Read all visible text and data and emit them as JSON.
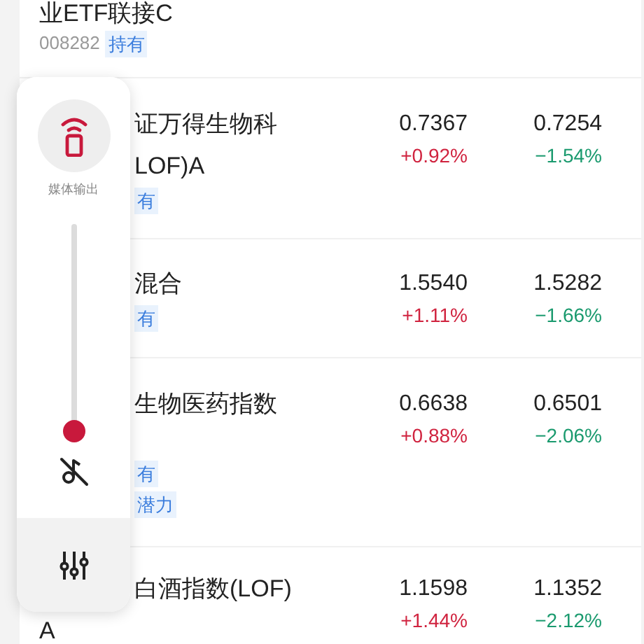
{
  "funds": [
    {
      "name_lines": [
        "业ETF联接C"
      ],
      "code": "008282",
      "tags": [
        "持有"
      ]
    },
    {
      "name_lines": [
        "证万得生物科",
        "LOF)A"
      ],
      "tags": [
        "有"
      ],
      "values": [
        {
          "price": "0.7367",
          "change": "+0.92%",
          "color": "#d0233f"
        },
        {
          "price": "0.7254",
          "change": "−1.54%",
          "color": "#1a9a6e"
        }
      ]
    },
    {
      "name_lines": [
        "混合"
      ],
      "tags": [
        "有"
      ],
      "values": [
        {
          "price": "1.5540",
          "change": "+1.11%",
          "color": "#d0233f"
        },
        {
          "price": "1.5282",
          "change": "−1.66%",
          "color": "#1a9a6e"
        }
      ]
    },
    {
      "name_lines": [
        "生物医药指数"
      ],
      "tags": [
        "有",
        "潜力"
      ],
      "values": [
        {
          "price": "0.6638",
          "change": "+0.88%",
          "color": "#d0233f"
        },
        {
          "price": "0.6501",
          "change": "−2.06%",
          "color": "#1a9a6e"
        }
      ]
    },
    {
      "name_lines": [
        "白酒指数(LOF)",
        "A"
      ],
      "values": [
        {
          "price": "1.1598",
          "change": "+1.44%",
          "color": "#d0233f"
        },
        {
          "price": "1.1352",
          "change": "−2.12%",
          "color": "#1a9a6e"
        }
      ]
    }
  ],
  "media_panel": {
    "output_label": "媒体输出",
    "volume": {
      "level": 0
    },
    "muted": true
  }
}
